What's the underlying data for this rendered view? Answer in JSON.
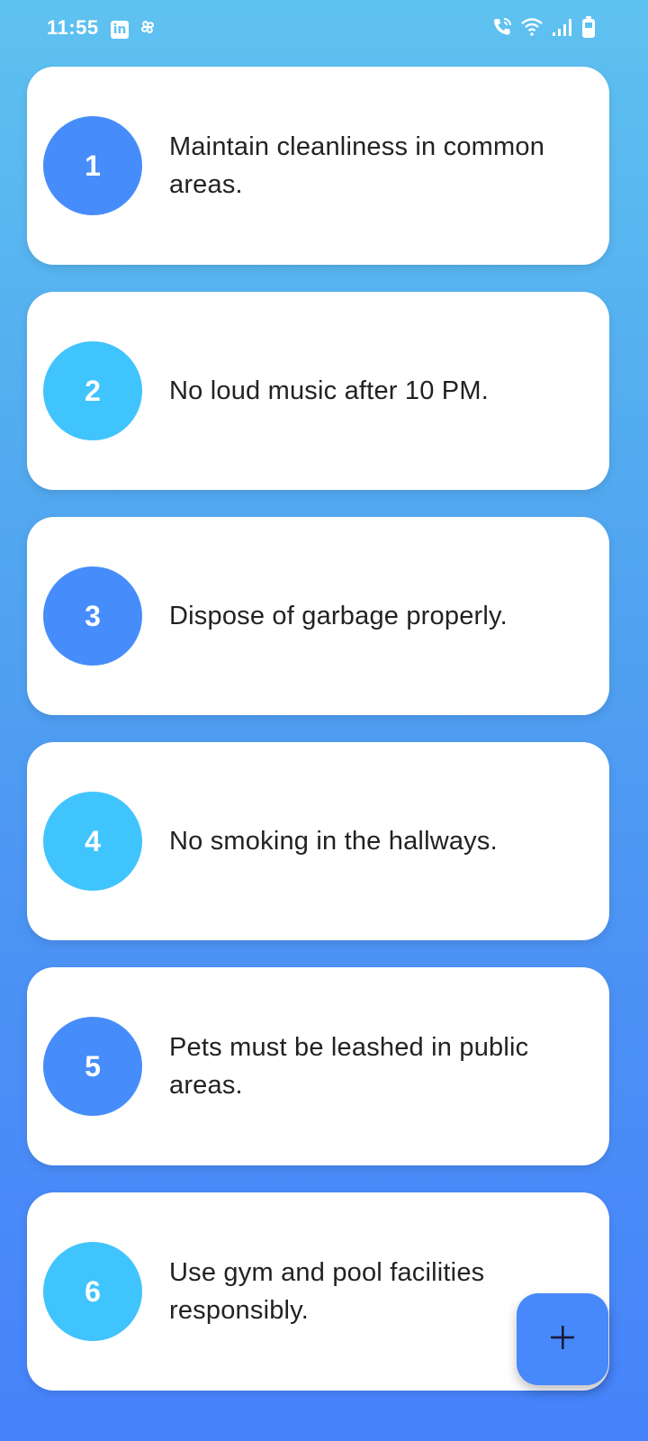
{
  "status_bar": {
    "time": "11:55",
    "left_icons": [
      "linkedin-icon",
      "pinwheel-icon"
    ],
    "right_icons": [
      "wifi-calling-icon",
      "wifi-icon",
      "signal-icon",
      "battery-icon"
    ]
  },
  "rules": [
    {
      "number": "1",
      "text": "Maintain cleanliness in common areas."
    },
    {
      "number": "2",
      "text": "No loud music after 10 PM."
    },
    {
      "number": "3",
      "text": "Dispose of garbage properly."
    },
    {
      "number": "4",
      "text": "No smoking in the hallways."
    },
    {
      "number": "5",
      "text": "Pets must be leashed in public areas."
    },
    {
      "number": "6",
      "text": "Use gym and pool facilities responsibly."
    }
  ],
  "fab": {
    "icon": "plus-icon"
  },
  "colors": {
    "circle_dark": "#468dfb",
    "circle_light": "#40c4fd",
    "fab": "#4788fb",
    "background_top": "#5ec2f0",
    "background_bottom": "#4683fb"
  }
}
